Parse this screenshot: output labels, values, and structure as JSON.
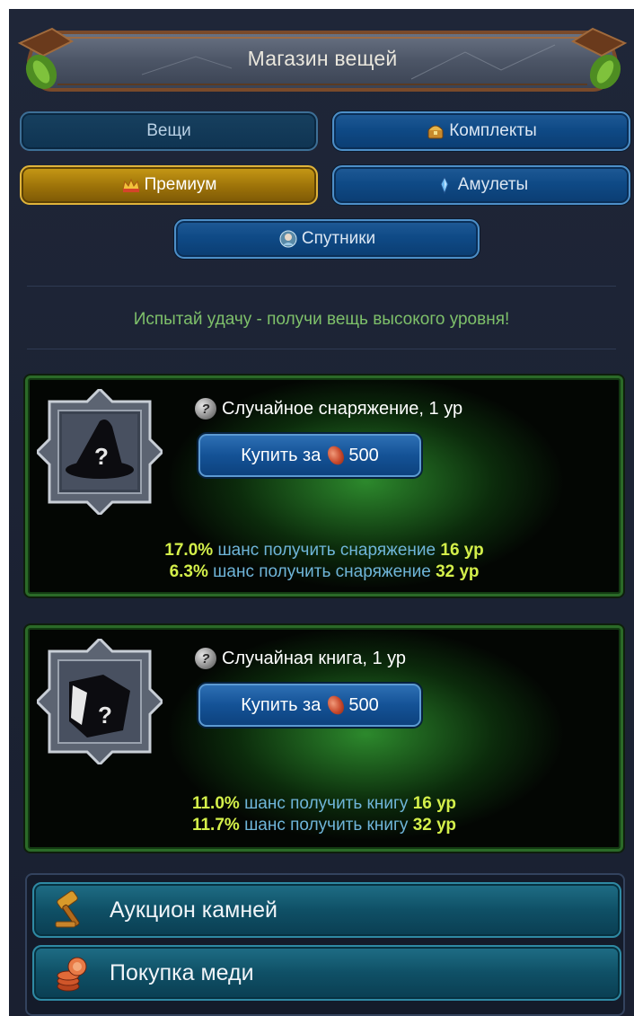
{
  "header": {
    "title": "Магазин вещей"
  },
  "tabs": [
    {
      "label": "Вещи",
      "icon": "none",
      "state": "inactive"
    },
    {
      "label": "Комплекты",
      "icon": "chest-icon",
      "state": "normal"
    },
    {
      "label": "Премиум",
      "icon": "crown-icon",
      "state": "active"
    },
    {
      "label": "Амулеты",
      "icon": "amulet-icon",
      "state": "normal"
    },
    {
      "label": "Спутники",
      "icon": "companion-icon",
      "state": "normal"
    }
  ],
  "promo_text": "Испытай удачу - получи вещь высокого уровня!",
  "items": [
    {
      "title": "Случайное снаряжение, 1 ур",
      "icon": "wizard-hat-icon",
      "buy_prefix": "Купить за",
      "price": "500",
      "chances": [
        {
          "pct": "17.0%",
          "text": "шанс получить снаряжение",
          "level": "16 ур"
        },
        {
          "pct": "6.3%",
          "text": "шанс получить снаряжение",
          "level": "32 ур"
        }
      ]
    },
    {
      "title": "Случайная книга, 1 ур",
      "icon": "spellbook-icon",
      "buy_prefix": "Купить за",
      "price": "500",
      "chances": [
        {
          "pct": "11.0%",
          "text": "шанс получить книгу",
          "level": "16 ур"
        },
        {
          "pct": "11.7%",
          "text": "шанс получить книгу",
          "level": "32 ур"
        }
      ]
    }
  ],
  "menu": [
    {
      "label": "Аукцион камней",
      "icon": "gavel-icon"
    },
    {
      "label": "Покупка меди",
      "icon": "copper-coins-icon"
    }
  ],
  "colors": {
    "promo": "#7ec06a",
    "chance_value": "#d4f04a",
    "chance_text": "#6fb5d9",
    "tab_active": "#b58610",
    "tab_normal": "#0f4a86"
  }
}
